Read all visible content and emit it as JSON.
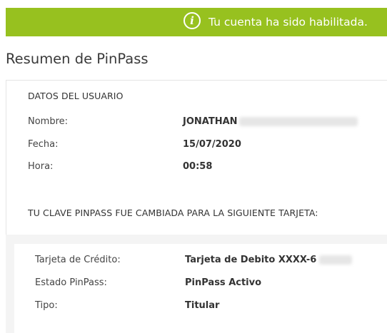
{
  "banner": {
    "icon": "info-circle-icon",
    "message": "Tu cuenta ha sido habilitada.",
    "color": "#97c11f"
  },
  "page": {
    "title": "Resumen de PinPass"
  },
  "user_data": {
    "heading": "DATOS DEL USUARIO",
    "rows": [
      {
        "label": "Nombre:",
        "value": "JONATHAN"
      },
      {
        "label": "Fecha:",
        "value": "15/07/2020"
      },
      {
        "label": "Hora:",
        "value": "00:58"
      }
    ]
  },
  "change_notice": {
    "heading": "TU CLAVE PINPASS FUE CAMBIADA PARA LA SIGUIENTE TARJETA:"
  },
  "card_details": {
    "rows": [
      {
        "label": "Tarjeta de Crédito:",
        "value": "Tarjeta de Debito XXXX-6"
      },
      {
        "label": "Estado PinPass:",
        "value": "PinPass Activo"
      },
      {
        "label": "Tipo:",
        "value": "Titular"
      }
    ]
  }
}
